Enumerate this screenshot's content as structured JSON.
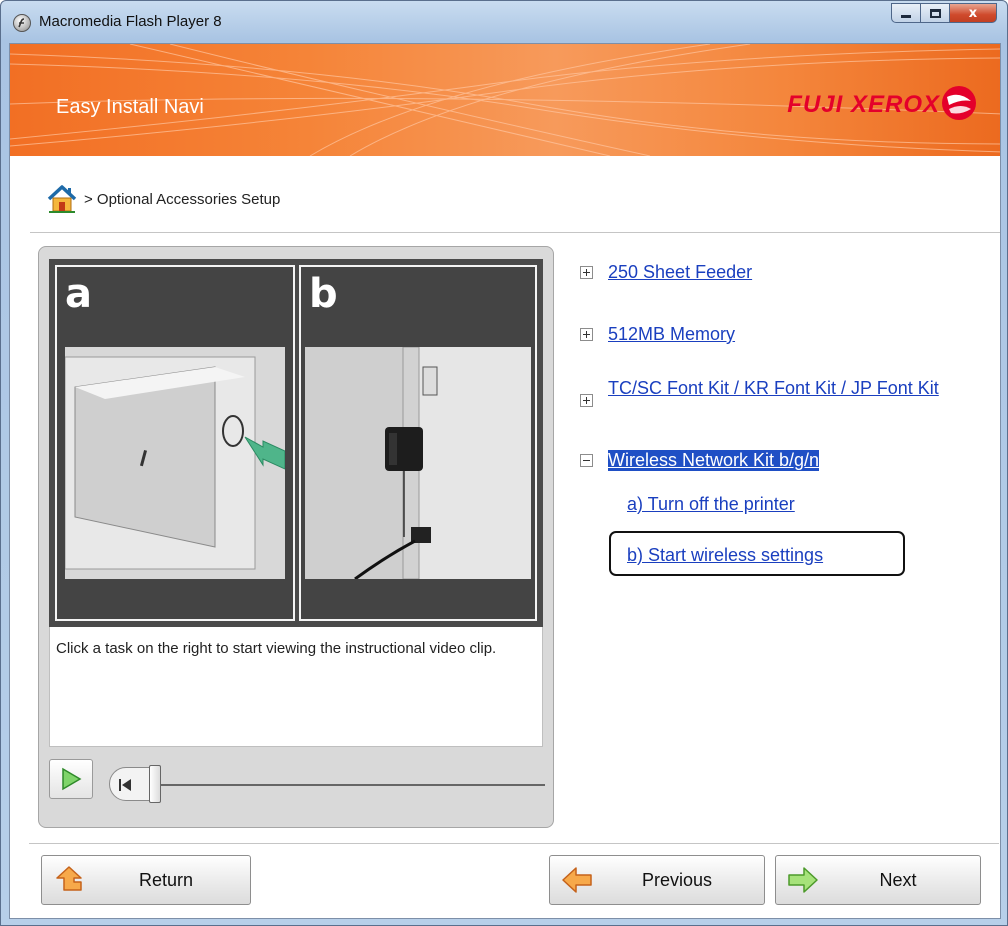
{
  "window": {
    "title": "Macromedia Flash Player 8",
    "close_glyph": "x"
  },
  "banner": {
    "title": "Easy Install Navi",
    "brand": "FUJI XEROX"
  },
  "breadcrumb": {
    "home_icon": "home-icon",
    "text": "> Optional Accessories Setup"
  },
  "video": {
    "frame_a_label": "a",
    "frame_b_label": "b",
    "caption": "Click a task on the right to start viewing the instructional video clip.",
    "progress": 0
  },
  "tasks": {
    "items": [
      {
        "label": "250 Sheet Feeder",
        "expanded": false
      },
      {
        "label": "512MB Memory",
        "expanded": false
      },
      {
        "label": "TC/SC Font Kit / KR Font Kit / JP Font Kit",
        "expanded": false
      },
      {
        "label": "Wireless Network Kit b/g/n",
        "expanded": true,
        "selected": true
      }
    ],
    "subitems": [
      {
        "label": "a) Turn off the printer"
      },
      {
        "label": "b) Start wireless settings",
        "highlighted": true
      }
    ]
  },
  "buttons": {
    "return": "Return",
    "previous": "Previous",
    "next": "Next"
  },
  "colors": {
    "banner_orange": "#f26f24",
    "brand_red": "#e4002b",
    "link_blue": "#1a3fbf",
    "selection_blue": "#1f4fc5"
  }
}
